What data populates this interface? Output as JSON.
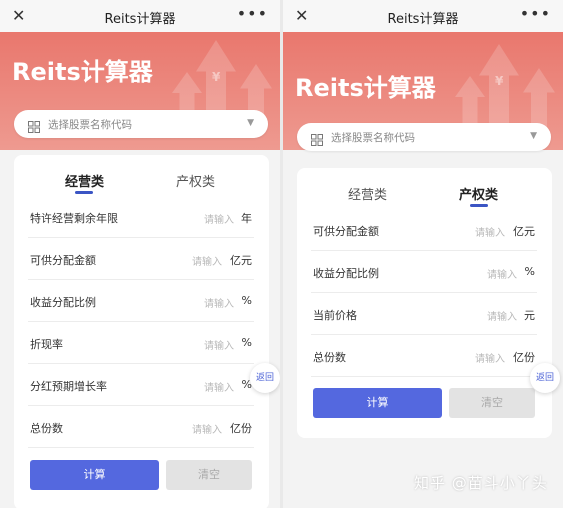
{
  "left": {
    "topbar": {
      "close_icon": "close-icon",
      "title": "Reits计算器",
      "more_icon": "more-icon"
    },
    "banner_title": "Reits计算器",
    "banner_glyph": "¥",
    "search_placeholder": "选择股票名称代码",
    "tabs": [
      {
        "label": "经营类",
        "active": true
      },
      {
        "label": "产权类",
        "active": false
      }
    ],
    "fields": [
      {
        "label": "特许经营剩余年限",
        "placeholder": "请输入",
        "unit": "年"
      },
      {
        "label": "可供分配金额",
        "placeholder": "请输入",
        "unit": "亿元"
      },
      {
        "label": "收益分配比例",
        "placeholder": "请输入",
        "unit": "%"
      },
      {
        "label": "折现率",
        "placeholder": "请输入",
        "unit": "%"
      },
      {
        "label": "分红预期增长率",
        "placeholder": "请输入",
        "unit": "%"
      },
      {
        "label": "总份数",
        "placeholder": "请输入",
        "unit": "亿份"
      }
    ],
    "calc_label": "计算",
    "clear_label": "清空",
    "back_label": "返回"
  },
  "right": {
    "topbar": {
      "close_icon": "close-icon",
      "title": "Reits计算器",
      "more_icon": "more-icon"
    },
    "banner_title": "Reits计算器",
    "banner_glyph": "¥",
    "search_placeholder": "选择股票名称代码",
    "tabs": [
      {
        "label": "经营类",
        "active": false
      },
      {
        "label": "产权类",
        "active": true
      }
    ],
    "fields": [
      {
        "label": "可供分配金额",
        "placeholder": "请输入",
        "unit": "亿元"
      },
      {
        "label": "收益分配比例",
        "placeholder": "请输入",
        "unit": "%"
      },
      {
        "label": "当前价格",
        "placeholder": "请输入",
        "unit": "元"
      },
      {
        "label": "总份数",
        "placeholder": "请输入",
        "unit": "亿份"
      }
    ],
    "calc_label": "计算",
    "clear_label": "清空",
    "back_label": "返回"
  },
  "watermark": "知乎 @苗斗小丫头",
  "colors": {
    "banner": "#e9776d",
    "accent": "#5468df",
    "tab_underline": "#3b55c4",
    "clear_bg": "#e3e3e3"
  }
}
